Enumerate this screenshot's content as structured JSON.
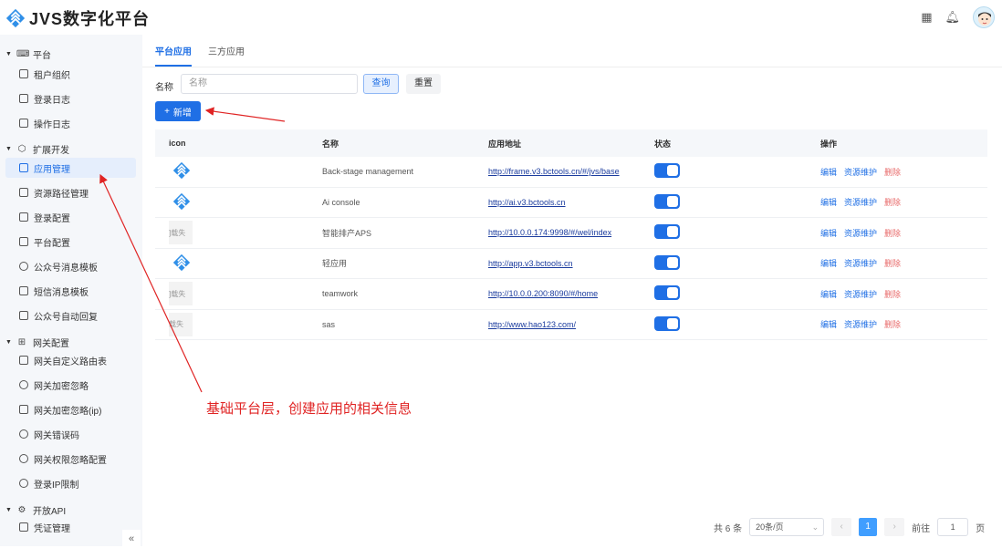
{
  "header": {
    "app_title": "JVS数字化平台",
    "icons": [
      "grid-icon",
      "bell-icon",
      "avatar"
    ]
  },
  "sidebar": {
    "groups": [
      {
        "label": "平台",
        "icon": "keyboard-icon",
        "items": [
          "租户组织",
          "登录日志",
          "操作日志"
        ]
      },
      {
        "label": "扩展开发",
        "icon": "cube-icon",
        "items": [
          "应用管理",
          "资源路径管理",
          "登录配置",
          "平台配置",
          "公众号消息模板",
          "短信消息模板",
          "公众号自动回复"
        ]
      },
      {
        "label": "网关配置",
        "icon": "network-icon",
        "items": [
          "网关自定义路由表",
          "网关加密忽略",
          "网关加密忽略(ip)",
          "网关错误码",
          "网关权限忽略配置",
          "登录IP限制"
        ]
      },
      {
        "label": "开放API",
        "icon": "gear-icon",
        "items": [
          "凭证管理"
        ]
      }
    ],
    "active_item": "应用管理",
    "collapse_symbol": "«"
  },
  "tabs": [
    "平台应用",
    "三方应用"
  ],
  "filter": {
    "label": "名称",
    "placeholder": "名称",
    "query_label": "查询",
    "reset_label": "重置"
  },
  "add_button": {
    "icon": "+",
    "label": "新增"
  },
  "table": {
    "columns": [
      "icon",
      "名称",
      "应用地址",
      "状态",
      "操作"
    ],
    "rows": [
      {
        "icon": "logo",
        "name": "Back-stage management",
        "url": "http://frame.v3.bctools.cn/#/jvs/base",
        "status": true
      },
      {
        "icon": "logo",
        "name": "Ai console",
        "url": "http://ai.v3.bctools.cn",
        "status": true
      },
      {
        "icon": "broken",
        "icon_text": "]载失",
        "name": "智能排产APS",
        "url": "http://10.0.0.174:9998/#/wel/index",
        "status": true
      },
      {
        "icon": "logo",
        "name": "轻应用",
        "url": "http://app.v3.bctools.cn",
        "status": true
      },
      {
        "icon": "broken",
        "icon_text": "]载失",
        "name": "teamwork",
        "url": "http://10.0.0.200:8090/#/home",
        "status": true
      },
      {
        "icon": "broken",
        "icon_text": "载失",
        "name": "sas",
        "url": "http://www.hao123.com/",
        "status": true
      }
    ],
    "actions": [
      "编辑",
      "资源维护",
      "删除"
    ]
  },
  "pagination": {
    "total_text": "共 6 条",
    "page_size": "20条/页",
    "current_page": "1",
    "goto_label": "前往",
    "goto_value": "1",
    "page_suffix": "页"
  },
  "annotation": {
    "text": "基础平台层，创建应用的相关信息",
    "color": "#e02424"
  },
  "colors": {
    "primary": "#1f6fe5",
    "danger": "#e86a6a",
    "link": "#1b3c9e"
  }
}
